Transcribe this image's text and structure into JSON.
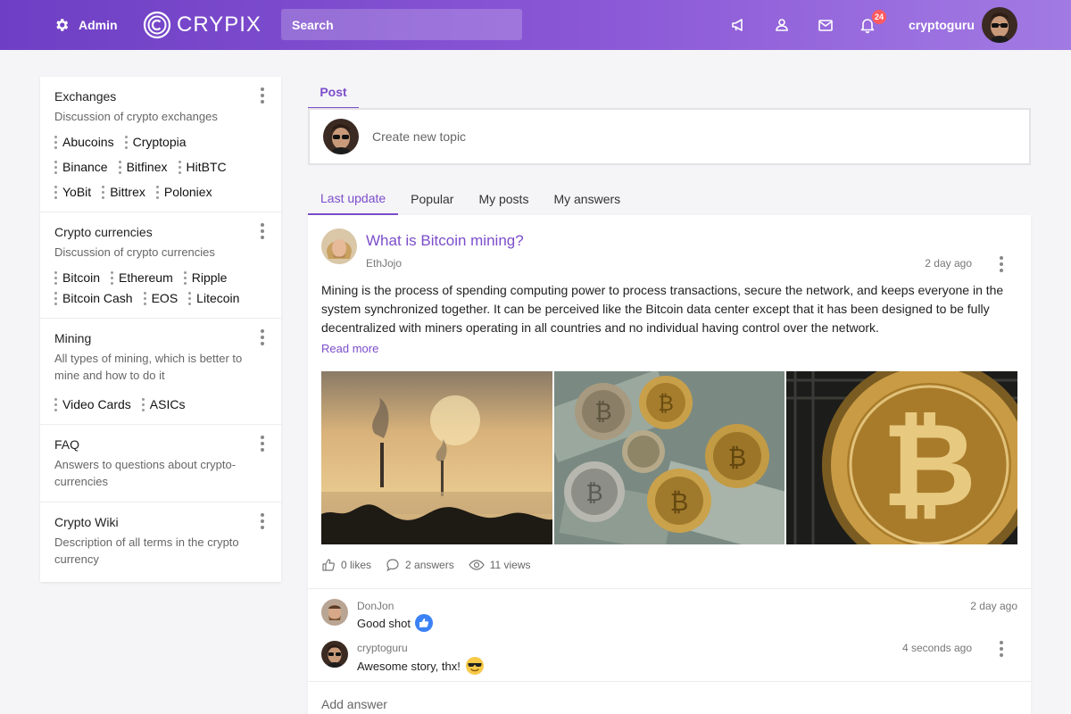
{
  "header": {
    "admin_label": "Admin",
    "brand": "CRYPIX",
    "search_placeholder": "Search",
    "notification_count": "24",
    "username": "cryptoguru",
    "accent": "#7c4dcb"
  },
  "sidebar": {
    "categories": [
      {
        "title": "Exchanges",
        "description": "Discussion of crypto exchanges",
        "tags": [
          "Abucoins",
          "Cryptopia",
          "Binance",
          "Bitfinex",
          "HitBTC",
          "YoBit",
          "Bittrex",
          "Poloniex"
        ]
      },
      {
        "title": "Crypto currencies",
        "description": "Discussion of crypto currencies",
        "tags": [
          "Bitcoin",
          "Ethereum",
          "Ripple",
          "Bitcoin Cash",
          "EOS",
          "Litecoin"
        ]
      },
      {
        "title": "Mining",
        "description": "All types of mining, which is better to mine and how to do it",
        "tags": [
          "Video Cards",
          "ASICs"
        ]
      },
      {
        "title": "FAQ",
        "description": "Answers to questions about crypto-currencies",
        "tags": []
      },
      {
        "title": "Crypto Wiki",
        "description": "Description of all terms in the crypto currency",
        "tags": []
      }
    ]
  },
  "compose": {
    "tab_label": "Post",
    "placeholder": "Create new topic"
  },
  "feed_tabs": [
    "Last update",
    "Popular",
    "My posts",
    "My answers"
  ],
  "post": {
    "title": "What is Bitcoin mining?",
    "author": "EthJojo",
    "time": "2 day ago",
    "body": "Mining is the process of spending computing power to process transactions, secure the network, and keeps everyone in the system synchronized together. It can be perceived like the Bitcoin data center except that it has been designed to be fully decentralized with miners operating in all countries and no individual having control over the network.",
    "read_more": "Read more",
    "likes": "0 likes",
    "answers": "2 answers",
    "views": "11 views"
  },
  "comments": [
    {
      "author": "DonJon",
      "text": "Good shot",
      "time": "2 day ago",
      "emoji": "thumbs-up-icon"
    },
    {
      "author": "cryptoguru",
      "text": "Awesome story, thx!",
      "time": "4 seconds ago",
      "emoji": "sunglasses-emoji-icon"
    }
  ],
  "add_answer_placeholder": "Add answer"
}
